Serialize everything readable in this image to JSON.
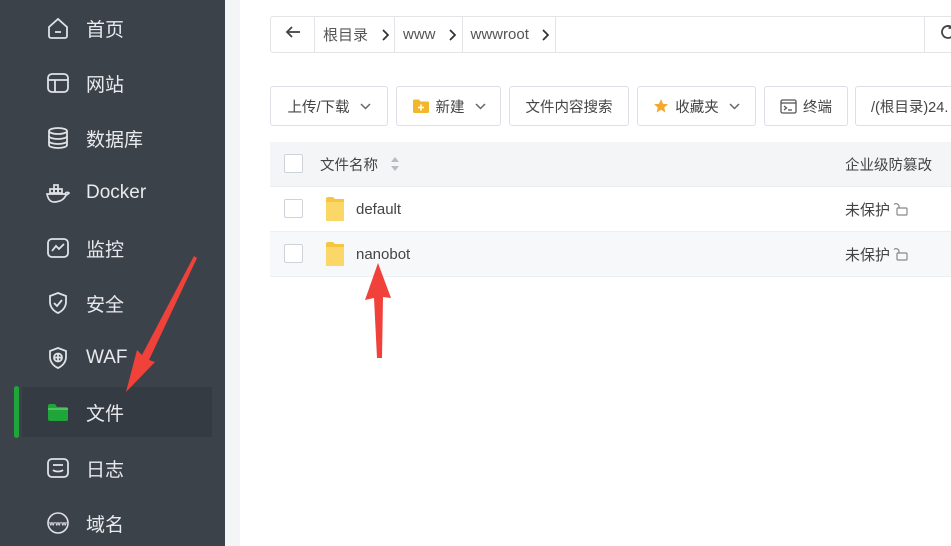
{
  "sidebar": {
    "items": [
      {
        "label": "首页",
        "icon": "home-icon"
      },
      {
        "label": "网站",
        "icon": "website-icon"
      },
      {
        "label": "数据库",
        "icon": "database-icon"
      },
      {
        "label": "Docker",
        "icon": "docker-icon"
      },
      {
        "label": "监控",
        "icon": "monitor-icon"
      },
      {
        "label": "安全",
        "icon": "shield-icon"
      },
      {
        "label": "WAF",
        "icon": "waf-shield-icon"
      },
      {
        "label": "文件",
        "icon": "folder-icon",
        "active": true
      },
      {
        "label": "日志",
        "icon": "log-icon"
      },
      {
        "label": "域名",
        "icon": "www-icon"
      }
    ]
  },
  "breadcrumb": {
    "segments": [
      "根目录",
      "www",
      "wwwroot"
    ]
  },
  "toolbar": {
    "upload": "上传/下载",
    "new": "新建",
    "search": "文件内容搜索",
    "favorites": "收藏夹",
    "terminal": "终端",
    "path": "/(根目录)24."
  },
  "table": {
    "columns": {
      "name": "文件名称",
      "protection": "企业级防篡改"
    },
    "rows": [
      {
        "name": "default",
        "protection": "未保护"
      },
      {
        "name": "nanobot",
        "protection": "未保护"
      }
    ]
  },
  "colors": {
    "sidebar_bg": "#3c424a",
    "accent": "#20a53a",
    "annotation_arrow": "#f0413b",
    "folder": "#f6c544"
  }
}
